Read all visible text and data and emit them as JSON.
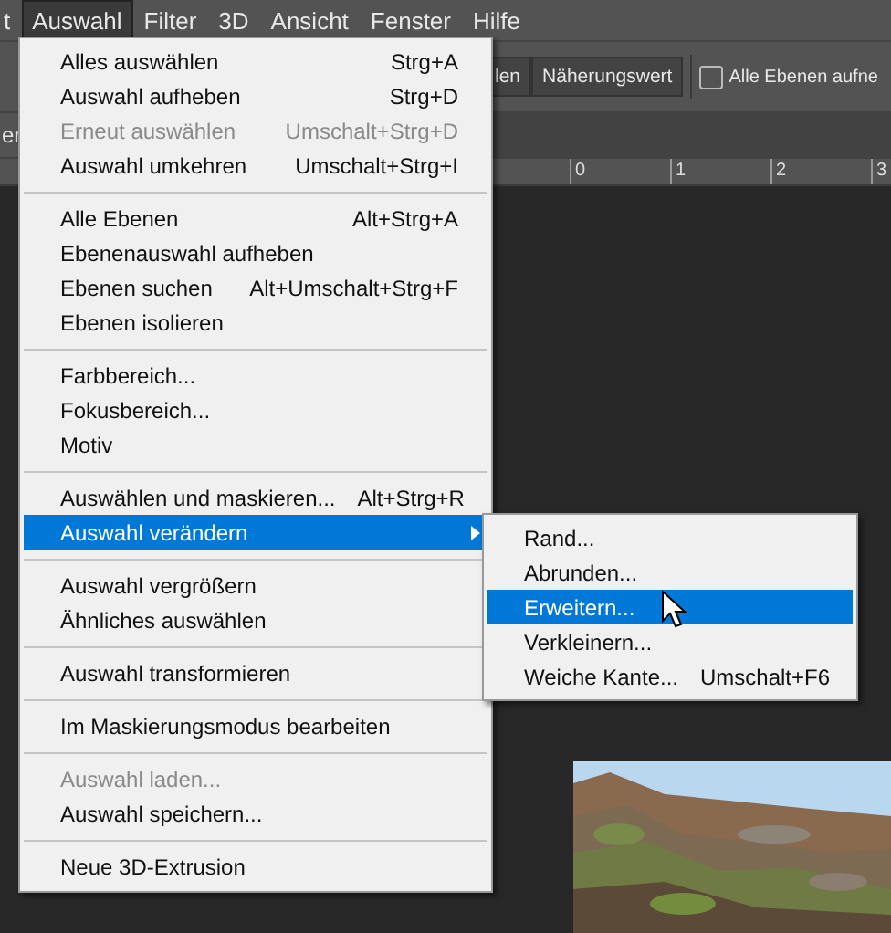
{
  "menubar": [
    {
      "label": "t",
      "selected": false
    },
    {
      "label": "Auswahl",
      "selected": true
    },
    {
      "label": "Filter",
      "selected": false
    },
    {
      "label": "3D",
      "selected": false
    },
    {
      "label": "Ansicht",
      "selected": false
    },
    {
      "label": "Fenster",
      "selected": false
    },
    {
      "label": "Hilfe",
      "selected": false
    }
  ],
  "options_bar": {
    "buttons": [
      "len",
      "Näherungswert"
    ],
    "checkbox": {
      "label": "Alle Ebenen aufne",
      "checked": false
    }
  },
  "document_tab": {
    "label": "er"
  },
  "ruler": {
    "labels": [
      "0",
      "1",
      "2",
      "3"
    ]
  },
  "menu": {
    "items": [
      {
        "kind": "item",
        "label": "Alles auswählen",
        "shortcut": "Strg+A",
        "disabled": false,
        "selected": false
      },
      {
        "kind": "item",
        "label": "Auswahl aufheben",
        "shortcut": "Strg+D",
        "disabled": false,
        "selected": false
      },
      {
        "kind": "item",
        "label": "Erneut auswählen",
        "shortcut": "Umschalt+Strg+D",
        "disabled": true,
        "selected": false
      },
      {
        "kind": "item",
        "label": "Auswahl umkehren",
        "shortcut": "Umschalt+Strg+I",
        "disabled": false,
        "selected": false
      },
      {
        "kind": "separator"
      },
      {
        "kind": "item",
        "label": "Alle Ebenen",
        "shortcut": "Alt+Strg+A",
        "disabled": false,
        "selected": false
      },
      {
        "kind": "item",
        "label": "Ebenenauswahl aufheben",
        "disabled": false,
        "selected": false
      },
      {
        "kind": "item",
        "label": "Ebenen suchen",
        "shortcut": "Alt+Umschalt+Strg+F",
        "disabled": false,
        "selected": false
      },
      {
        "kind": "item",
        "label": "Ebenen isolieren",
        "disabled": false,
        "selected": false
      },
      {
        "kind": "separator"
      },
      {
        "kind": "item",
        "label": "Farbbereich...",
        "disabled": false,
        "selected": false
      },
      {
        "kind": "item",
        "label": "Fokusbereich...",
        "disabled": false,
        "selected": false
      },
      {
        "kind": "item",
        "label": "Motiv",
        "disabled": false,
        "selected": false
      },
      {
        "kind": "separator"
      },
      {
        "kind": "item",
        "label": "Auswählen und maskieren...",
        "shortcut": "Alt+Strg+R",
        "disabled": false,
        "selected": false
      },
      {
        "kind": "item",
        "label": "Auswahl verändern",
        "disabled": false,
        "selected": true,
        "submenu": true
      },
      {
        "kind": "separator"
      },
      {
        "kind": "item",
        "label": "Auswahl vergrößern",
        "disabled": false,
        "selected": false
      },
      {
        "kind": "item",
        "label": "Ähnliches auswählen",
        "disabled": false,
        "selected": false
      },
      {
        "kind": "separator"
      },
      {
        "kind": "item",
        "label": "Auswahl transformieren",
        "disabled": false,
        "selected": false
      },
      {
        "kind": "separator"
      },
      {
        "kind": "item",
        "label": "Im Maskierungsmodus bearbeiten",
        "disabled": false,
        "selected": false
      },
      {
        "kind": "separator"
      },
      {
        "kind": "item",
        "label": "Auswahl laden...",
        "disabled": true,
        "selected": false
      },
      {
        "kind": "item",
        "label": "Auswahl speichern...",
        "disabled": false,
        "selected": false
      },
      {
        "kind": "separator"
      },
      {
        "kind": "item",
        "label": "Neue 3D-Extrusion",
        "disabled": false,
        "selected": false
      }
    ]
  },
  "submenu": {
    "items": [
      {
        "label": "Rand...",
        "selected": false
      },
      {
        "label": "Abrunden...",
        "selected": false
      },
      {
        "label": "Erweitern...",
        "selected": true
      },
      {
        "label": "Verkleinern...",
        "selected": false
      },
      {
        "label": "Weiche Kante...",
        "shortcut": "Umschalt+F6",
        "selected": false
      }
    ]
  }
}
